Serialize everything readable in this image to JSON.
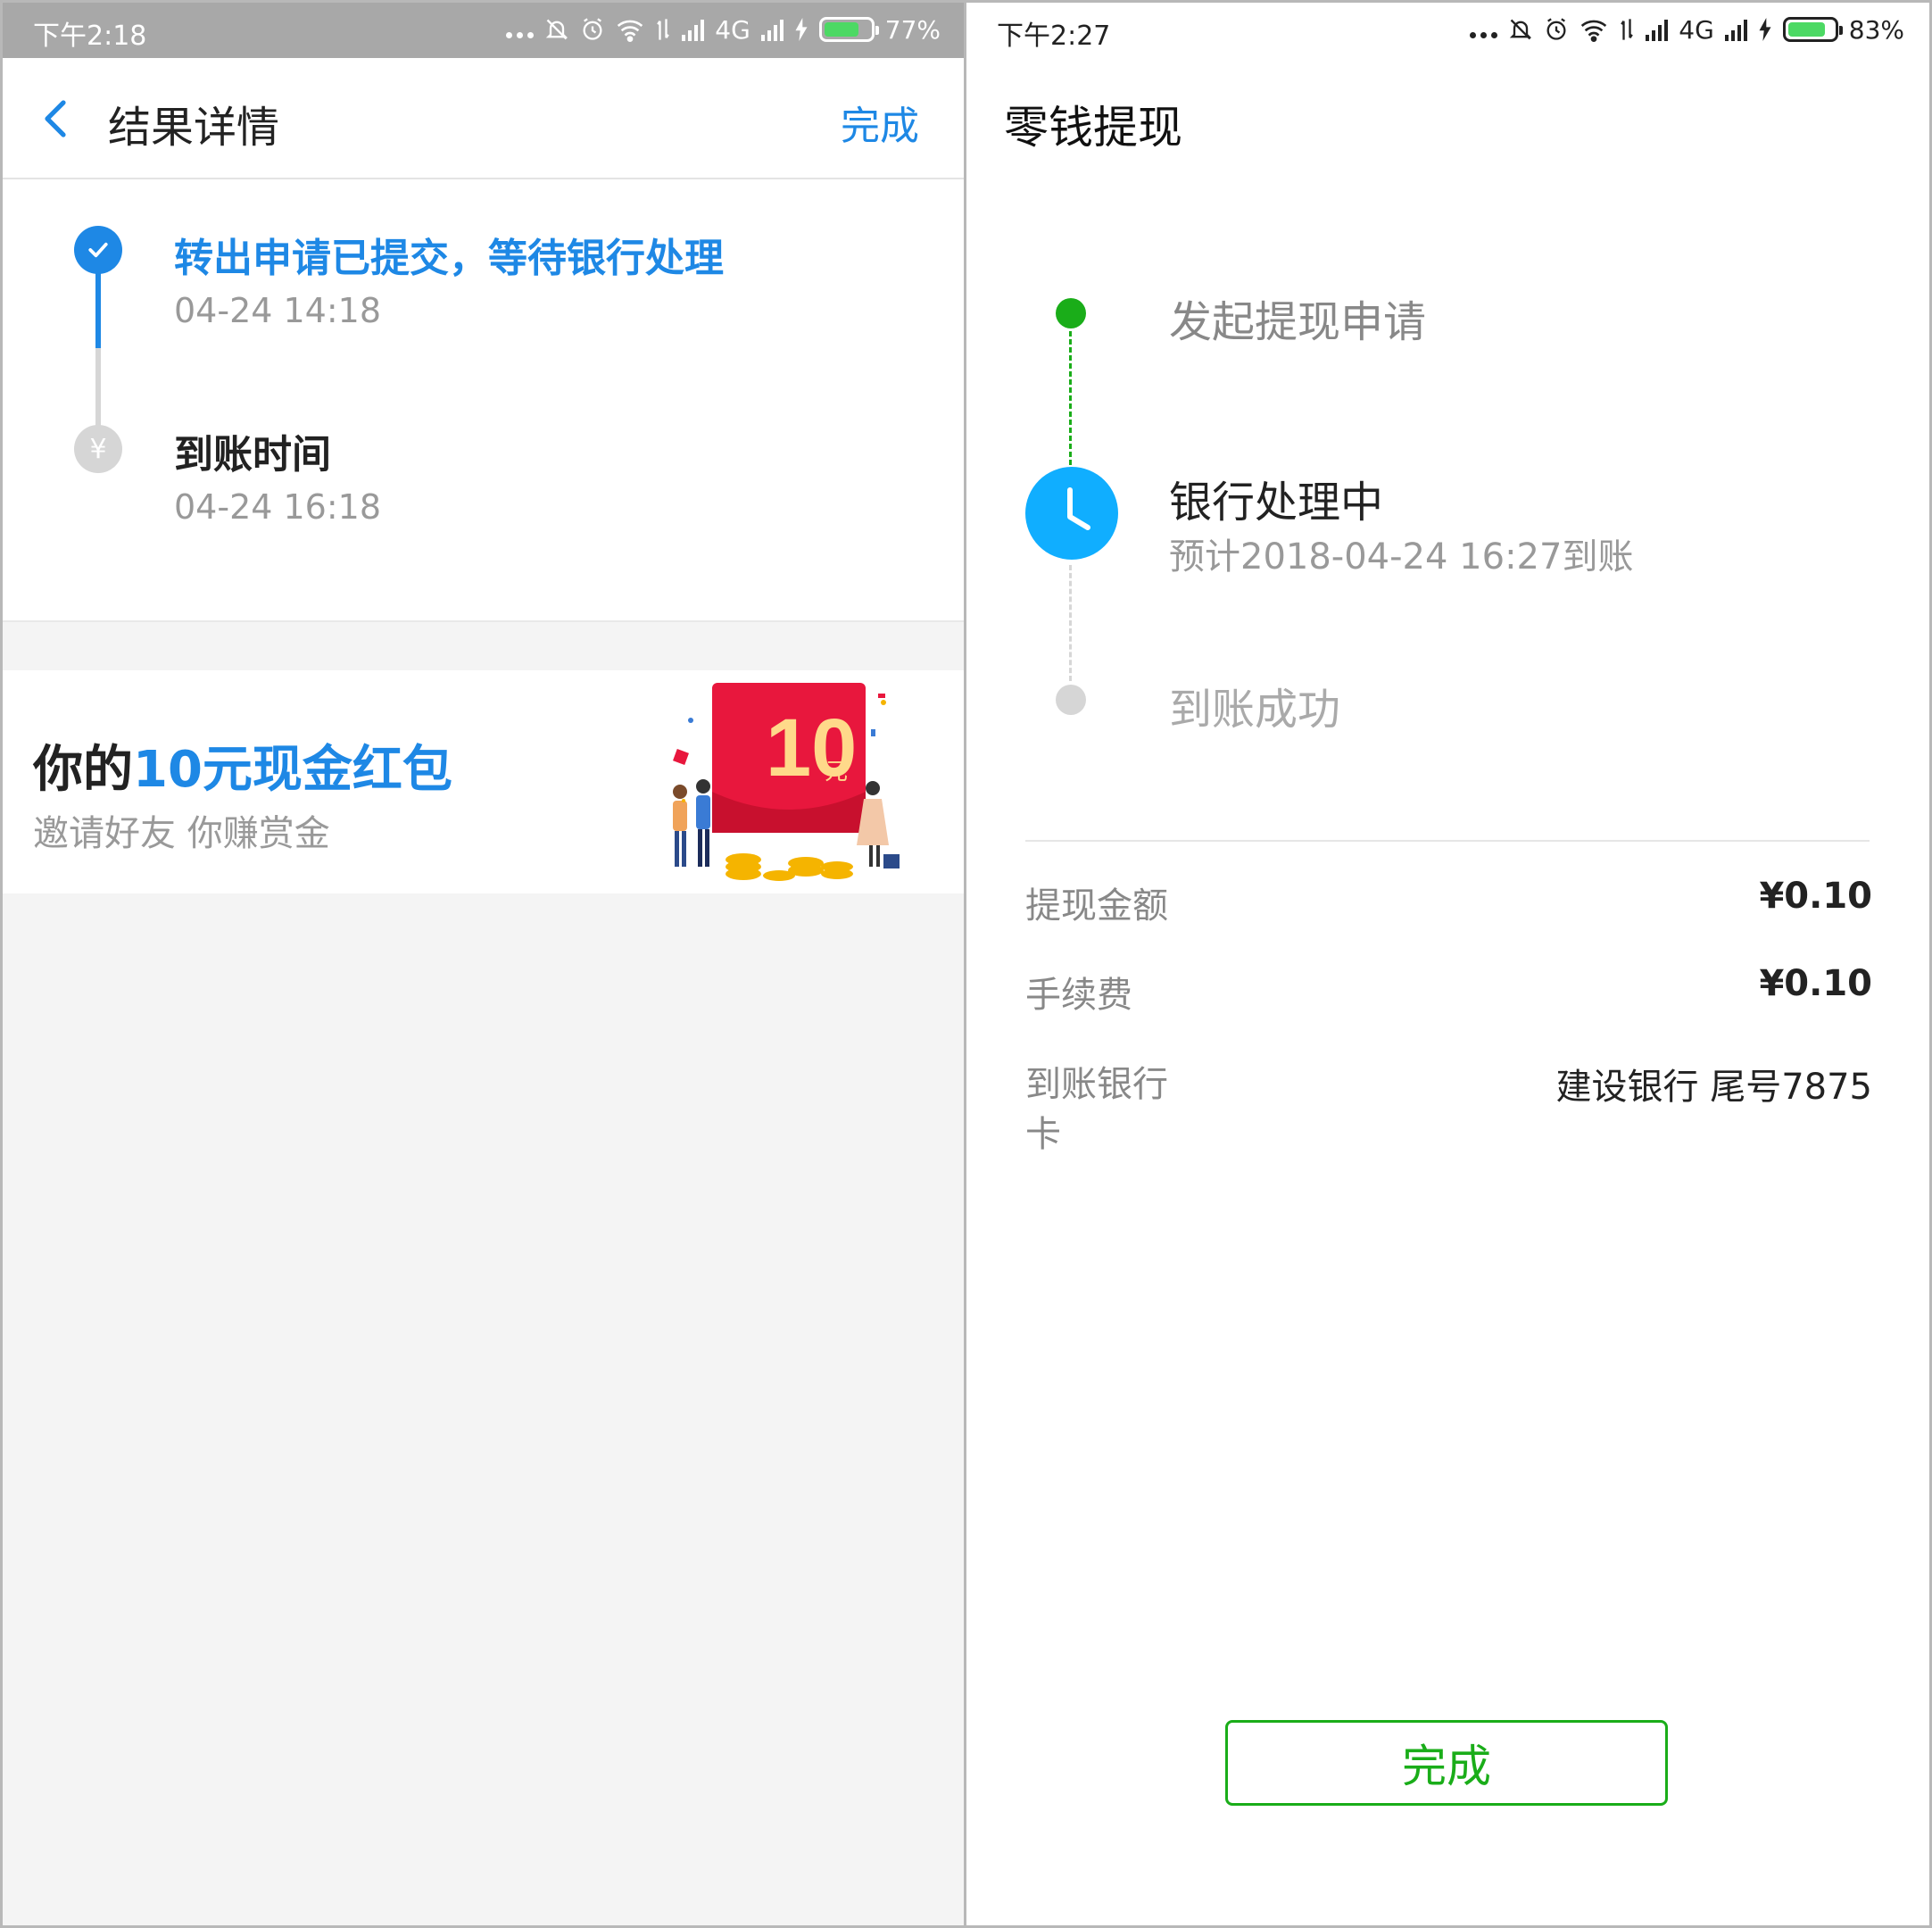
{
  "left": {
    "status_bar": {
      "time": "下午2:18",
      "network": "4G",
      "battery": "77%",
      "battery_level": 0.77
    },
    "nav": {
      "title": "结果详情",
      "done": "完成"
    },
    "steps": [
      {
        "title": "转出申请已提交，等待银行处理",
        "time": "04-24 14:18"
      },
      {
        "title": "到账时间",
        "time": "04-24 16:18",
        "icon_glyph": "¥"
      }
    ],
    "promo": {
      "title_prefix": "你的",
      "title_highlight": "10元现金红包",
      "subtitle": "邀请好友 你赚赏金",
      "art_amount": "10",
      "art_unit": "元"
    }
  },
  "right": {
    "status_bar": {
      "time": "下午2:27",
      "network": "4G",
      "battery": "83%",
      "battery_level": 0.83
    },
    "title": "零钱提现",
    "timeline": [
      {
        "label": "发起提现申请"
      },
      {
        "label": "银行处理中",
        "sub": "预计2018-04-24 16:27到账"
      },
      {
        "label": "到账成功"
      }
    ],
    "details": [
      {
        "label": "提现金额",
        "value": "¥0.10"
      },
      {
        "label": "手续费",
        "value": "¥0.10"
      },
      {
        "label": "到账银行卡",
        "value": "建设银行 尾号7875"
      }
    ],
    "done_button": "完成"
  },
  "colors": {
    "blue_accent": "#1e88e5",
    "green_accent": "#1aad19",
    "clock_blue": "#10aeff",
    "promo_red": "#e8173d",
    "gray_status": "#a8a8a8"
  }
}
